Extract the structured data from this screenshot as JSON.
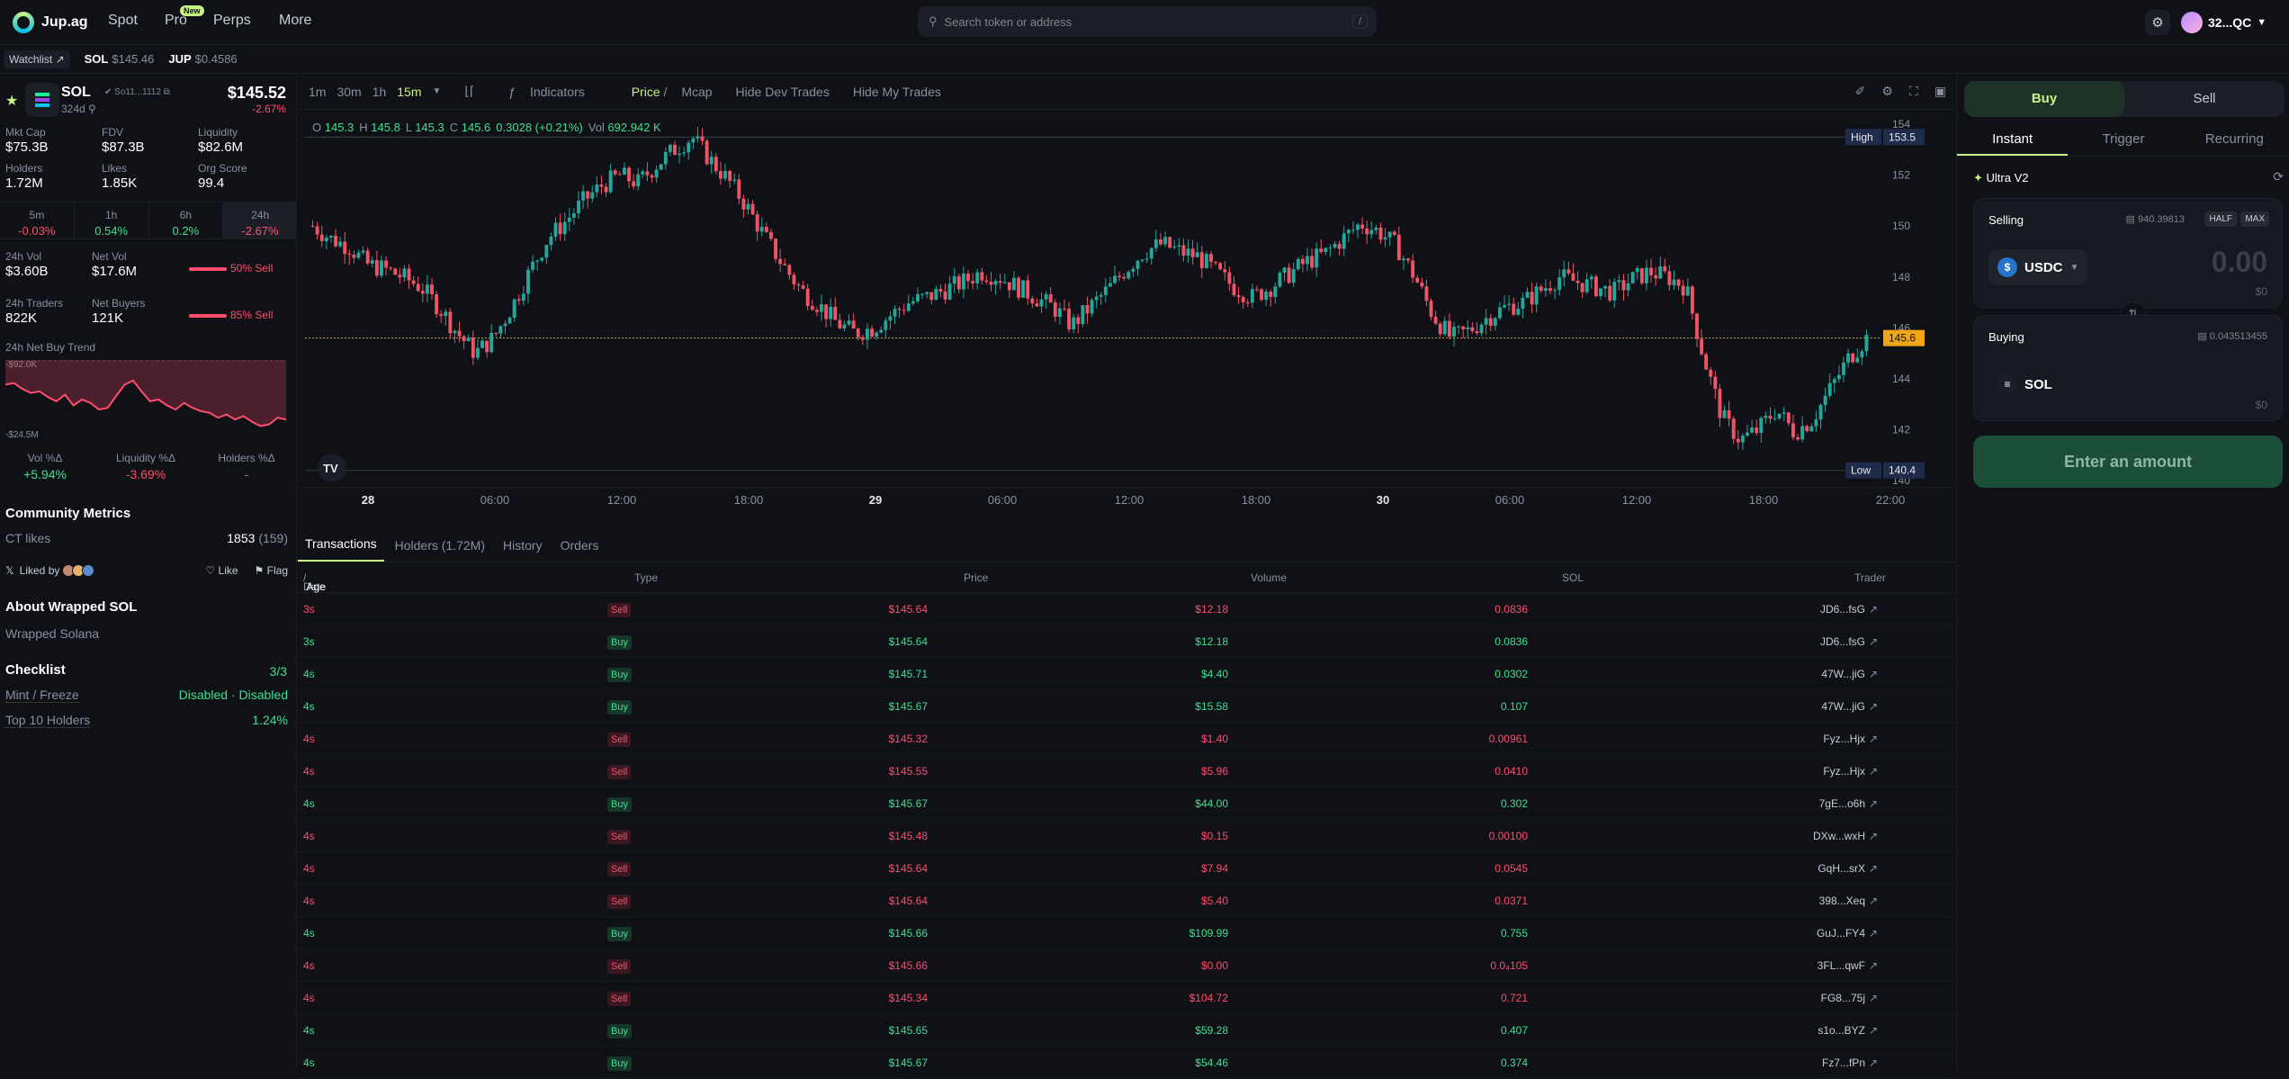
{
  "header": {
    "brand": "Jup.ag",
    "nav": [
      "Spot",
      "Pro",
      "Perps",
      "More"
    ],
    "new_badge": "New",
    "search_placeholder": "Search token or address",
    "search_shortcut": "/",
    "wallet": "32...QC"
  },
  "ticker": {
    "watchlist": "Watchlist ↗",
    "items": [
      {
        "symbol": "SOL",
        "price": "$145.46"
      },
      {
        "symbol": "JUP",
        "price": "$0.4586"
      }
    ]
  },
  "token": {
    "symbol": "SOL",
    "address": "So11...1112",
    "age": "324d",
    "price": "$145.52",
    "change": "-2.67%",
    "stats": [
      {
        "label": "Mkt Cap",
        "value": "$75.3B"
      },
      {
        "label": "FDV",
        "value": "$87.3B"
      },
      {
        "label": "Liquidity",
        "value": "$82.6M"
      },
      {
        "label": "Holders",
        "value": "1.72M"
      },
      {
        "label": "Likes",
        "value": "1.85K"
      },
      {
        "label": "Org Score",
        "value": "99.4"
      }
    ],
    "timeframes": [
      {
        "label": "5m",
        "change": "-0.03%"
      },
      {
        "label": "1h",
        "change": "0.54%"
      },
      {
        "label": "6h",
        "change": "0.2%"
      },
      {
        "label": "24h",
        "change": "-2.67%"
      }
    ],
    "vol24_label": "24h Vol",
    "vol24": "$3.60B",
    "netvol_label": "Net Vol",
    "netvol": "$17.6M",
    "sell1": "50% Sell",
    "traders_label": "24h Traders",
    "traders": "822K",
    "netbuyers_label": "Net Buyers",
    "netbuyers": "121K",
    "sell2": "85% Sell",
    "trend_label": "24h Net Buy Trend",
    "trend_top": "-$92.0K",
    "trend_bottom": "-$24.5M",
    "trend_series": [
      30,
      28,
      35,
      40,
      38,
      45,
      50,
      42,
      55,
      48,
      52,
      60,
      58,
      44,
      30,
      25,
      38,
      50,
      48,
      55,
      60,
      52,
      58,
      62,
      64,
      70,
      66,
      72,
      68,
      75,
      80,
      78,
      70,
      72
    ],
    "deltas": [
      {
        "label": "Vol %Δ",
        "value": "+5.94%"
      },
      {
        "label": "Liquidity %Δ",
        "value": "-3.69%"
      },
      {
        "label": "Holders %Δ",
        "value": "-"
      }
    ]
  },
  "community": {
    "title": "Community Metrics",
    "ct_label": "CT likes",
    "ct_value": "1853",
    "ct_sub": "(159)",
    "liked_by": "Liked by",
    "like": "Like",
    "flag": "Flag"
  },
  "about": {
    "title": "About Wrapped SOL",
    "text": "Wrapped Solana"
  },
  "checklist": {
    "title": "Checklist",
    "score": "3/3",
    "mint_label": "Mint / Freeze",
    "mint_value": "Disabled · Disabled",
    "top10_label": "Top 10 Holders",
    "top10_value": "1.24%"
  },
  "chart_toolbar": {
    "intervals": [
      "1m",
      "30m",
      "1h",
      "15m"
    ],
    "indicators": "Indicators",
    "price": "Price",
    "mcap": "Mcap",
    "hide_dev": "Hide Dev Trades",
    "hide_my": "Hide My Trades"
  },
  "ohlc": {
    "o": "145.3",
    "h": "145.8",
    "l": "145.3",
    "c": "145.6",
    "chg": "0.3028 (+0.21%)",
    "vol": "692.942 K"
  },
  "chart_data": {
    "type": "candlestick",
    "y_ticks": [
      "154",
      "152",
      "150",
      "148",
      "146",
      "144",
      "142",
      "140"
    ],
    "ylim": [
      140,
      154.5
    ],
    "x_ticks": [
      "28",
      "06:00",
      "12:00",
      "18:00",
      "29",
      "06:00",
      "12:00",
      "18:00",
      "30",
      "06:00",
      "12:00",
      "18:00",
      "22:00"
    ],
    "high_label": "High",
    "high": "153.5",
    "low_label": "Low",
    "low": "140.4",
    "current": "145.6",
    "close_path": [
      150.0,
      149.5,
      149.2,
      148.5,
      148.3,
      148.0,
      147.6,
      146.8,
      145.8,
      145.0,
      145.6,
      146.8,
      148.2,
      149.5,
      150.2,
      151.0,
      151.6,
      152.0,
      151.7,
      152.4,
      153.0,
      153.5,
      152.6,
      151.8,
      150.8,
      149.6,
      148.5,
      147.5,
      146.9,
      146.2,
      145.8,
      146.0,
      146.5,
      147.0,
      147.2,
      147.5,
      147.8,
      148.2,
      148.0,
      147.6,
      147.2,
      146.8,
      146.1,
      146.8,
      147.5,
      148.3,
      149.0,
      149.3,
      149.0,
      148.8,
      148.2,
      147.6,
      147.2,
      147.6,
      148.1,
      148.6,
      148.9,
      149.5,
      150.1,
      149.8,
      149.2,
      148.0,
      146.5,
      145.6,
      145.9,
      146.4,
      146.8,
      147.0,
      147.5,
      148.0,
      147.8,
      147.6,
      147.4,
      147.9,
      148.2,
      148.0,
      147.6,
      144.8,
      142.5,
      141.6,
      142.0,
      142.8,
      141.9,
      142.4,
      143.6,
      144.8,
      145.6
    ]
  },
  "tabs": [
    "Transactions",
    "Holders (1.72M)",
    "History",
    "Orders"
  ],
  "table": {
    "headers": {
      "date": "Date",
      "age": "Age",
      "type": "Type",
      "price": "Price",
      "volume": "Volume",
      "sol": "SOL",
      "trader": "Trader"
    },
    "rows": [
      {
        "age": "3s",
        "type": "Sell",
        "price": "$145.64",
        "volume": "$12.18",
        "sol": "0.0836",
        "trader": "JD6...fsG"
      },
      {
        "age": "3s",
        "type": "Buy",
        "price": "$145.64",
        "volume": "$12.18",
        "sol": "0.0836",
        "trader": "JD6...fsG"
      },
      {
        "age": "4s",
        "type": "Buy",
        "price": "$145.71",
        "volume": "$4.40",
        "sol": "0.0302",
        "trader": "47W...jiG"
      },
      {
        "age": "4s",
        "type": "Buy",
        "price": "$145.67",
        "volume": "$15.58",
        "sol": "0.107",
        "trader": "47W...jiG"
      },
      {
        "age": "4s",
        "type": "Sell",
        "price": "$145.32",
        "volume": "$1.40",
        "sol": "0.00961",
        "trader": "Fyz...Hjx"
      },
      {
        "age": "4s",
        "type": "Sell",
        "price": "$145.55",
        "volume": "$5.96",
        "sol": "0.0410",
        "trader": "Fyz...Hjx"
      },
      {
        "age": "4s",
        "type": "Buy",
        "price": "$145.67",
        "volume": "$44.00",
        "sol": "0.302",
        "trader": "7gE...o6h"
      },
      {
        "age": "4s",
        "type": "Sell",
        "price": "$145.48",
        "volume": "$0.15",
        "sol": "0.00100",
        "trader": "DXw...wxH"
      },
      {
        "age": "4s",
        "type": "Sell",
        "price": "$145.64",
        "volume": "$7.94",
        "sol": "0.0545",
        "trader": "GqH...srX"
      },
      {
        "age": "4s",
        "type": "Sell",
        "price": "$145.64",
        "volume": "$5.40",
        "sol": "0.0371",
        "trader": "398...Xeq"
      },
      {
        "age": "4s",
        "type": "Buy",
        "price": "$145.66",
        "volume": "$109.99",
        "sol": "0.755",
        "trader": "GuJ...FY4"
      },
      {
        "age": "4s",
        "type": "Sell",
        "price": "$145.66",
        "volume": "$0.00",
        "sol": "0.0₄105",
        "trader": "3FL...qwF"
      },
      {
        "age": "4s",
        "type": "Sell",
        "price": "$145.34",
        "volume": "$104.72",
        "sol": "0.721",
        "trader": "FG8...75j"
      },
      {
        "age": "4s",
        "type": "Buy",
        "price": "$145.65",
        "volume": "$59.28",
        "sol": "0.407",
        "trader": "s1o...BYZ"
      },
      {
        "age": "4s",
        "type": "Buy",
        "price": "$145.67",
        "volume": "$54.46",
        "sol": "0.374",
        "trader": "Fz7...fPn"
      }
    ]
  },
  "swap": {
    "buy": "Buy",
    "sell": "Sell",
    "tabs": [
      "Instant",
      "Trigger",
      "Recurring"
    ],
    "ultra": "Ultra V2",
    "selling": "Selling",
    "sell_balance": "940.39813",
    "half": "HALF",
    "max": "MAX",
    "sell_token": "USDC",
    "sell_amount": "0.00",
    "sell_usd": "$0",
    "buying": "Buying",
    "buy_balance": "0.043513455",
    "buy_token": "SOL",
    "buy_usd": "$0",
    "cta": "Enter an amount"
  }
}
